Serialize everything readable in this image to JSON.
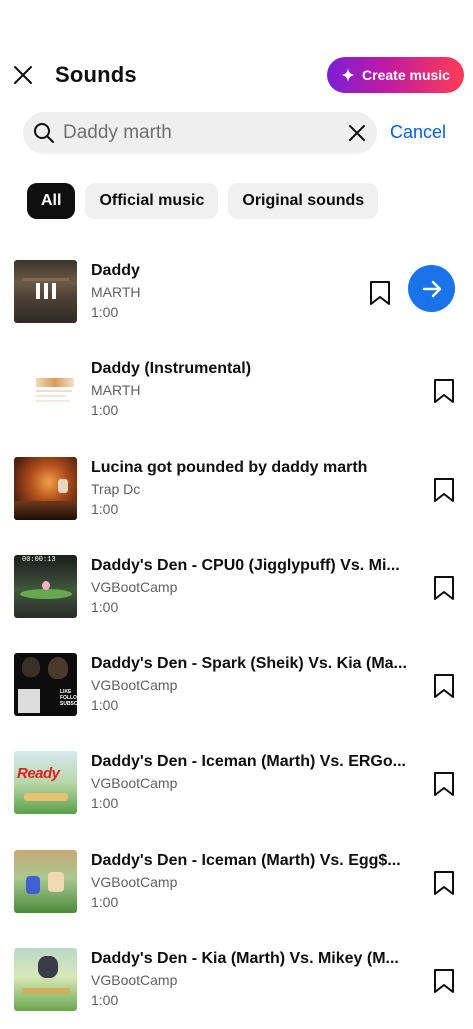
{
  "header": {
    "title": "Sounds",
    "create_label": "Create music"
  },
  "search": {
    "value": "Daddy marth",
    "placeholder": "Search",
    "cancel_label": "Cancel"
  },
  "chips": [
    {
      "label": "All",
      "active": true
    },
    {
      "label": "Official music",
      "active": false
    },
    {
      "label": "Original sounds",
      "active": false
    }
  ],
  "results": [
    {
      "title": "Daddy",
      "artist": "MARTH",
      "duration": "1:00"
    },
    {
      "title": "Daddy (Instrumental)",
      "artist": "MARTH",
      "duration": "1:00"
    },
    {
      "title": "Lucina got pounded by daddy marth",
      "artist": "Trap Dc",
      "duration": "1:00"
    },
    {
      "title": "Daddy's Den - CPU0 (Jigglypuff) Vs. Mi...",
      "artist": "VGBootCamp",
      "duration": "1:00"
    },
    {
      "title": "Daddy's Den - Spark (Sheik) Vs. Kia (Ma...",
      "artist": "VGBootCamp",
      "duration": "1:00"
    },
    {
      "title": "Daddy's Den - Iceman (Marth) Vs. ERGo...",
      "artist": "VGBootCamp",
      "duration": "1:00"
    },
    {
      "title": "Daddy's Den - Iceman (Marth) Vs. Egg$...",
      "artist": "VGBootCamp",
      "duration": "1:00"
    },
    {
      "title": "Daddy's Den - Kia (Marth) Vs. Mikey (M...",
      "artist": "VGBootCamp",
      "duration": "1:00"
    }
  ],
  "thumbnail_text": {
    "t4": "00:00:13",
    "t5": "LIKE FOLLOW SUBSCRIBE",
    "t6": "Ready"
  },
  "colors": {
    "accent": "#065fd4",
    "go_button": "#1a73e8",
    "chip_active": "#0f0f0f",
    "chip_bg": "#f0f0f0",
    "search_bg": "#efefef"
  },
  "icons": [
    "close-icon",
    "sparkle-icon",
    "search-icon",
    "clear-icon",
    "bookmark-icon",
    "arrow-right-icon",
    "pause-bars-icon"
  ]
}
